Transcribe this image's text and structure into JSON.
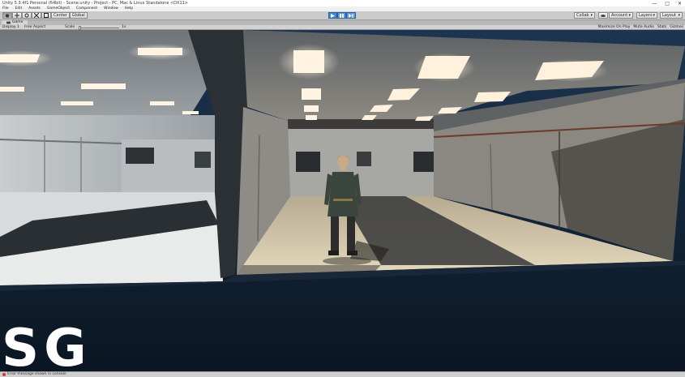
{
  "window": {
    "title": "Unity 5.3.4f1 Personal (64bit) - Scene.unity - Project - PC, Mac & Linux Standalone <DX11>",
    "controls": [
      "—",
      "□",
      "✕"
    ]
  },
  "menu": [
    "File",
    "Edit",
    "Assets",
    "GameObject",
    "Component",
    "Window",
    "Help"
  ],
  "toolbar": {
    "tools": [
      "hand-icon",
      "move-icon",
      "rotate-icon",
      "scale-icon",
      "rect-icon"
    ],
    "pivot_label": "Center",
    "space_label": "Global",
    "playback": [
      "play-icon",
      "pause-icon",
      "step-icon"
    ],
    "collab_label": "Collab",
    "account_label": "Account",
    "layers_label": "Layers",
    "layout_label": "Layout"
  },
  "tabs": {
    "game_label": "Game"
  },
  "game_toolbar": {
    "display_label": "Display 1",
    "aspect_label": "Free Aspect",
    "scale_label": "Scale",
    "scale_value": "1x",
    "buttons": [
      "Maximize On Play",
      "Mute Audio",
      "Stats",
      "Gizmos"
    ]
  },
  "status": {
    "message": "Error message shown in console"
  },
  "logo_text": "SG",
  "colors": {
    "play_accent": "#3d8ad8",
    "floor_shadow": "#1b1f24",
    "void": "#0f1e2e"
  }
}
